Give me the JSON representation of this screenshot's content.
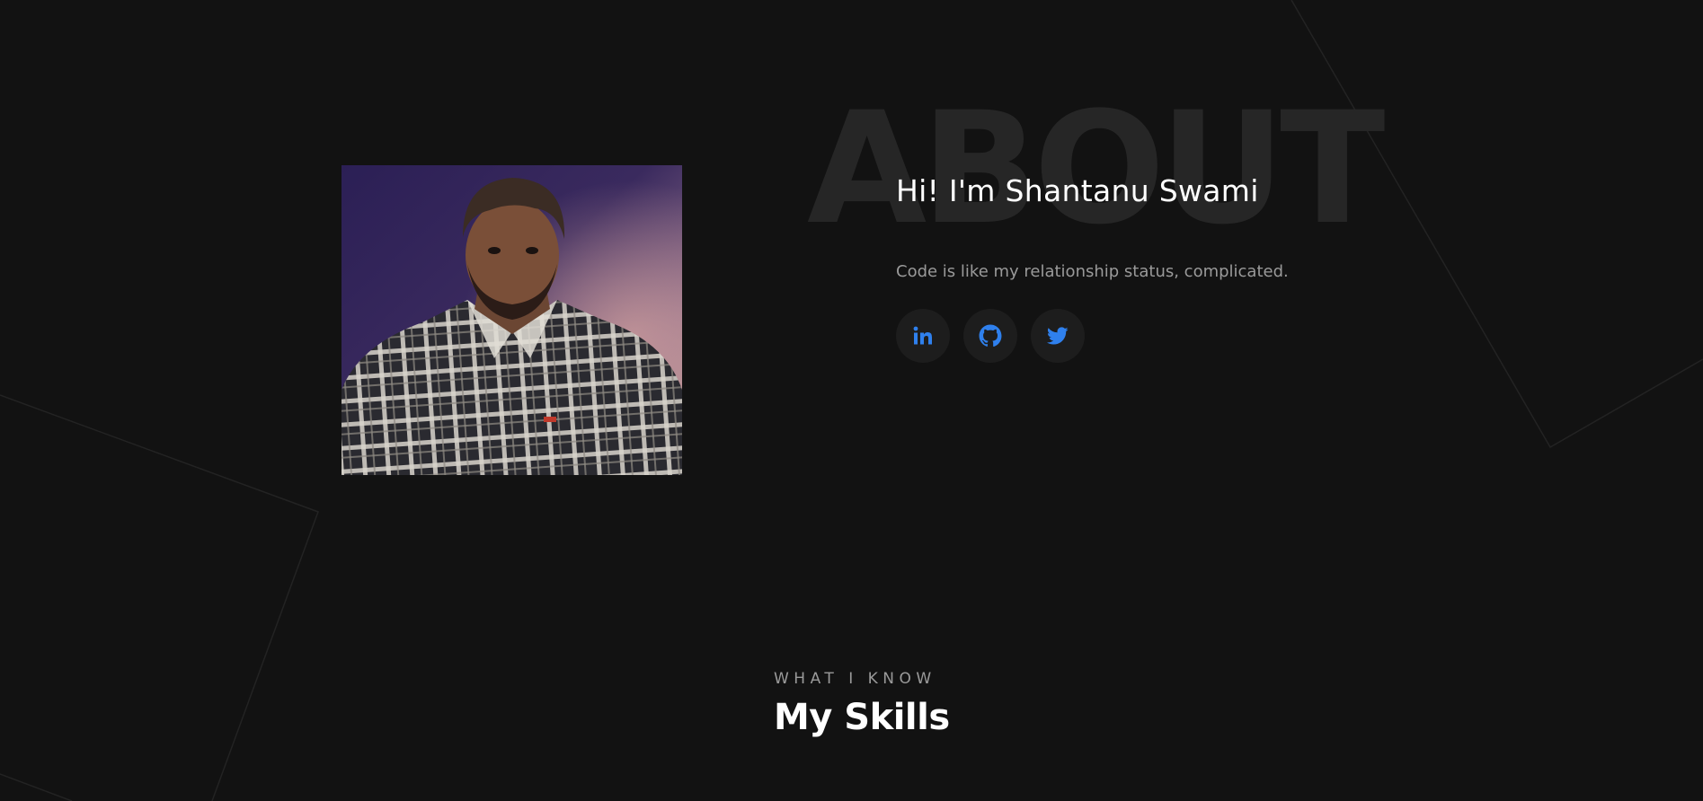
{
  "about": {
    "watermark": "ABOUT",
    "heading": "Hi! I'm Shantanu Swami",
    "tagline": "Code is like my relationship status, complicated.",
    "photo_icon": "profile-photo",
    "socials": [
      {
        "name": "LinkedIn",
        "icon": "linkedin-icon"
      },
      {
        "name": "GitHub",
        "icon": "github-icon"
      },
      {
        "name": "Twitter",
        "icon": "twitter-icon"
      }
    ]
  },
  "skills": {
    "eyebrow": "WHAT I KNOW",
    "title": "My Skills"
  },
  "colors": {
    "background": "#121212",
    "accent": "#2f80ed",
    "watermark": "#262626",
    "muted_text": "#9a9a9a",
    "social_bg": "#1d1d1d"
  }
}
